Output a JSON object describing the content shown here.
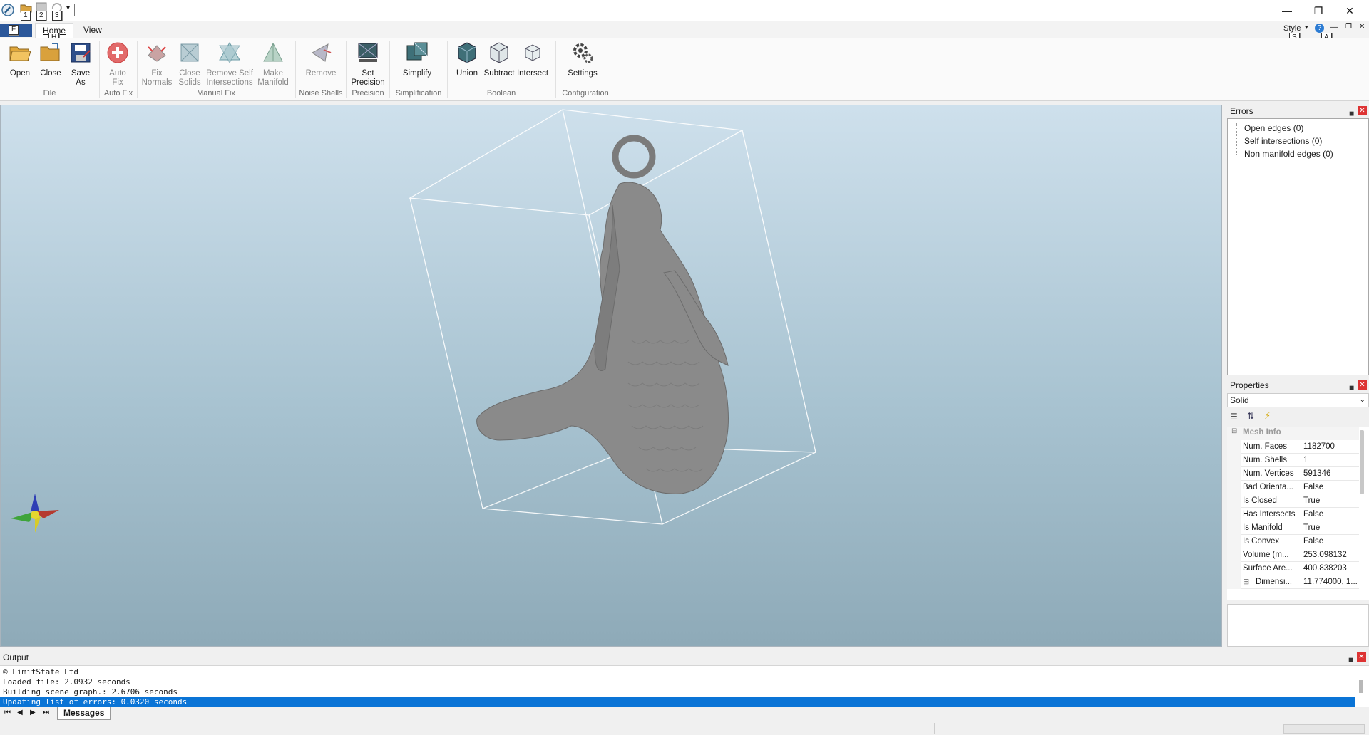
{
  "titlebar": {
    "keytips": [
      "1",
      "2",
      "3"
    ],
    "controls": [
      "minimize",
      "restore",
      "close"
    ]
  },
  "ribbon": {
    "file_keytip": "F",
    "home_keytip": "H",
    "tabs": [
      "Home",
      "View"
    ],
    "style_label": "Style",
    "style_keytip": "S",
    "help_keytip": "A",
    "buttons": {
      "open": "Open",
      "close": "Close",
      "save_as_1": "Save",
      "save_as_2": "As",
      "auto_fix_1": "Auto",
      "auto_fix_2": "Fix",
      "fix_normals_1": "Fix",
      "fix_normals_2": "Normals",
      "close_solids_1": "Close",
      "close_solids_2": "Solids",
      "remove_self_1": "Remove Self",
      "remove_self_2": "Intersections",
      "make_manifold_1": "Make",
      "make_manifold_2": "Manifold",
      "remove": "Remove",
      "set_precision_1": "Set",
      "set_precision_2": "Precision",
      "simplify": "Simplify",
      "union": "Union",
      "subtract": "Subtract",
      "intersect": "Intersect",
      "settings": "Settings"
    },
    "groups": {
      "file": "File",
      "auto_fix": "Auto Fix",
      "manual_fix": "Manual Fix",
      "noise_shells": "Noise Shells",
      "precision": "Precision",
      "simplification": "Simplification",
      "boolean": "Boolean",
      "configuration": "Configuration"
    }
  },
  "errors_panel": {
    "title": "Errors",
    "items": [
      "Open edges (0)",
      "Self intersections (0)",
      "Non manifold edges (0)"
    ]
  },
  "properties_panel": {
    "title": "Properties",
    "selected": "Solid",
    "category": "Mesh Info",
    "rows": [
      {
        "name": "Num. Faces",
        "value": "1182700"
      },
      {
        "name": "Num. Shells",
        "value": "1"
      },
      {
        "name": "Num. Vertices",
        "value": "591346"
      },
      {
        "name": "Bad Orienta...",
        "value": "False"
      },
      {
        "name": "Is Closed",
        "value": "True"
      },
      {
        "name": "Has Intersects",
        "value": "False"
      },
      {
        "name": "Is Manifold",
        "value": "True"
      },
      {
        "name": "Is Convex",
        "value": "False"
      },
      {
        "name": "Volume (m...",
        "value": "253.098132"
      },
      {
        "name": "Surface Are...",
        "value": "400.838203"
      },
      {
        "name": "Dimensi...",
        "value": "11.774000, 1..."
      }
    ]
  },
  "output_panel": {
    "title": "Output",
    "lines": [
      "© LimitState Ltd",
      "Loaded file: 2.0932 seconds",
      "Building scene graph.: 2.6706 seconds",
      "Updating list of errors: 0.0320 seconds"
    ],
    "tab": "Messages"
  },
  "colors": {
    "accent": "#0a74d6",
    "file_tab": "#2b579a",
    "viewport_top": "#cee0ec",
    "viewport_bottom": "#8eaab8",
    "mesh": "#8a8a8a"
  }
}
